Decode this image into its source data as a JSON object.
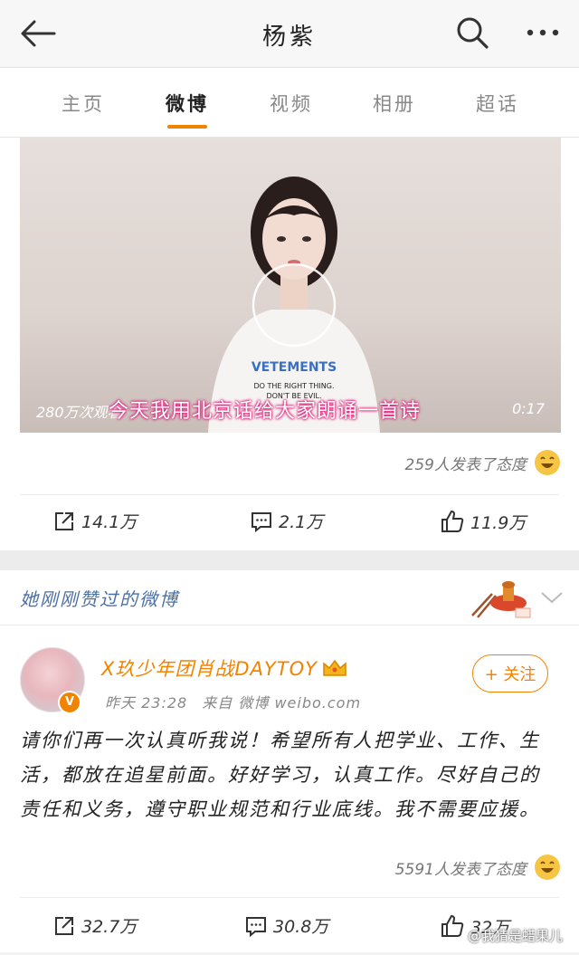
{
  "header": {
    "title": "杨紫",
    "icons": [
      "back-arrow-icon",
      "search-icon",
      "more-icon"
    ]
  },
  "tabs": [
    {
      "label": "主页",
      "active": false
    },
    {
      "label": "微博",
      "active": true
    },
    {
      "label": "视频",
      "active": false
    },
    {
      "label": "相册",
      "active": false
    },
    {
      "label": "超话",
      "active": false
    }
  ],
  "post1": {
    "video": {
      "views": "280万次观看",
      "caption": "今天我用北京话给大家朗诵一首诗",
      "duration": "0:17",
      "shirt_text": "VETEMENTS",
      "shirt_sub1": "DO THE RIGHT THING.",
      "shirt_sub2": "DON'T BE EVIL."
    },
    "reactions": "259人发表了态度",
    "share_count": "14.1万",
    "comment_count": "2.1万",
    "like_count": "11.9万"
  },
  "liked_section": {
    "title": "她刚刚赞过的微博"
  },
  "post2": {
    "username": "X玖少年团肖战DAYTOY",
    "time": "昨天 23:28",
    "source": "来自 微博 weibo.com",
    "follow_label": "+ 关注",
    "text": "请你们再一次认真听我说！希望所有人把学业、工作、生活，都放在追星前面。好好学习，认真工作。尽好自己的责任和义务，遵守职业规范和行业底线。我不需要应援。",
    "reactions": "5591人发表了态度",
    "share_count": "32.7万",
    "comment_count": "30.8万",
    "like_count": "32万"
  },
  "watermark": "@我猜是蜡果儿",
  "colors": {
    "accent": "#f08300",
    "link_blue": "#4a6fa5"
  }
}
